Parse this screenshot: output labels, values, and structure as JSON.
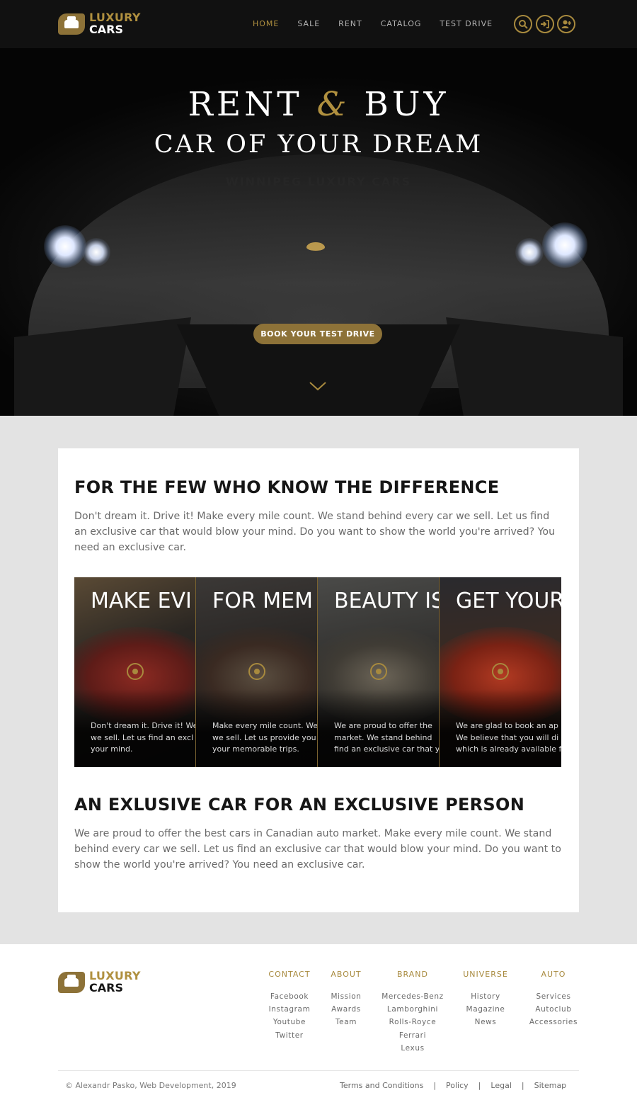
{
  "brand": {
    "word1": "LUXURY",
    "word2": "CARS"
  },
  "nav": [
    {
      "label": "HOME",
      "active": true
    },
    {
      "label": "SALE"
    },
    {
      "label": "RENT"
    },
    {
      "label": "CATALOG"
    },
    {
      "label": "TEST DRIVE"
    }
  ],
  "header_icons": [
    "search-icon",
    "sign-in-icon",
    "add-user-icon"
  ],
  "hero": {
    "title_left": "RENT",
    "title_amp": "&",
    "title_right": "BUY",
    "subtitle": "CAR OF YOUR DREAM",
    "tagline": "WINNIPEG LUXURY CARS",
    "cta": "BOOK YOUR TEST DRIVE",
    "scroll_icon": "chevron-down-icon"
  },
  "section1": {
    "heading": "FOR THE FEW WHO KNOW THE DIFFERENCE",
    "text": "Don't dream it. Drive it! Make every mile count. We stand behind every car we sell. Let us find an exclusive car that would blow your mind. Do you want to show the world you're arrived? You need an exclusive car."
  },
  "panels": [
    {
      "title": "MAKE EVI",
      "lines": [
        "Don't dream it. Drive it! We",
        "we sell. Let us find an excl",
        "your mind."
      ]
    },
    {
      "title": "FOR MEM",
      "lines": [
        "Make every mile count. We",
        "we sell. Let us provide you",
        "your memorable trips."
      ]
    },
    {
      "title": "BEAUTY IS",
      "lines": [
        "We are proud to offer the",
        "market. We stand behind",
        "find an exclusive car that y"
      ]
    },
    {
      "title": "GET YOUR",
      "lines": [
        "We are glad to book an ap",
        "We believe that you will di",
        "which is already available f"
      ]
    }
  ],
  "section2": {
    "heading": "AN EXLUSIVE CAR FOR AN EXCLUSIVE PERSON",
    "text": "We are proud to offer the best cars in Canadian auto market. Make every mile count. We stand behind every car we sell. Let us find an exclusive car that would blow your mind. Do you want to show the world you're arrived? You need an exclusive car."
  },
  "footer": {
    "columns": [
      {
        "heading": "CONTACT",
        "links": [
          "Facebook",
          "Instagram",
          "Youtube",
          "Twitter"
        ]
      },
      {
        "heading": "ABOUT",
        "links": [
          "Mission",
          "Awards",
          "Team"
        ]
      },
      {
        "heading": "BRAND",
        "links": [
          "Mercedes-Benz",
          "Lamborghini",
          "Rolls-Royce",
          "Ferrari",
          "Lexus"
        ]
      },
      {
        "heading": "UNIVERSE",
        "links": [
          "History",
          "Magazine",
          "News"
        ]
      },
      {
        "heading": "AUTO",
        "links": [
          "Services",
          "Autoclub",
          "Accessories"
        ]
      }
    ],
    "copyright": "© Alexandr Pasko, Web Development, 2019",
    "legal": [
      "Terms and Conditions",
      "Policy",
      "Legal",
      "Sitemap"
    ],
    "separator": "|"
  },
  "colors": {
    "accent": "#a88a3e",
    "header_bg": "#111111",
    "page_bg": "#e3e3e3"
  }
}
